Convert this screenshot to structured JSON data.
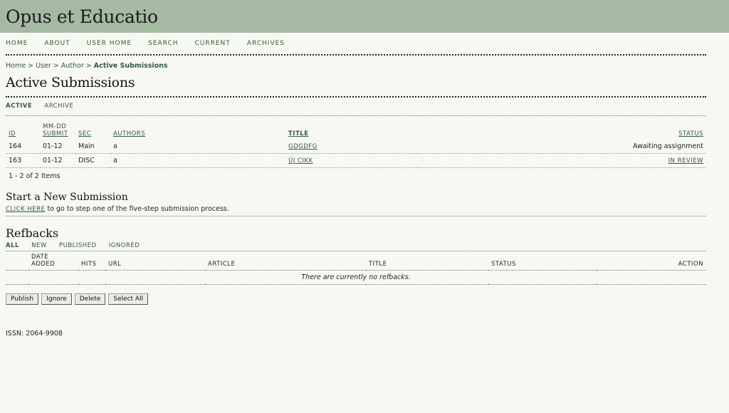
{
  "site": {
    "title": "Opus et Educatio"
  },
  "nav": [
    {
      "label": "HOME"
    },
    {
      "label": "ABOUT"
    },
    {
      "label": "USER HOME"
    },
    {
      "label": "SEARCH"
    },
    {
      "label": "CURRENT"
    },
    {
      "label": "ARCHIVES"
    }
  ],
  "breadcrumb": {
    "home": "Home",
    "sep": ">",
    "user": "User",
    "author": "Author",
    "current": "Active Submissions"
  },
  "page": {
    "title": "Active Submissions"
  },
  "subtabs": {
    "active": "ACTIVE",
    "archive": "ARCHIVE"
  },
  "submissions": {
    "headers": {
      "id": "ID",
      "date_top": "MM-DD",
      "date": "SUBMIT",
      "sec": "SEC",
      "authors": "AUTHORS",
      "title": "TITLE",
      "status": "STATUS"
    },
    "rows": [
      {
        "id": "164",
        "date": "01-12",
        "sec": "Main",
        "authors": "a",
        "title": "GDGDFG",
        "status": "Awaiting assignment"
      },
      {
        "id": "163",
        "date": "01-12",
        "sec": "DISC",
        "authors": "a",
        "title": "ÚJ CIKK",
        "status": "IN REVIEW"
      }
    ],
    "count": "1 - 2 of 2 Items"
  },
  "new_submission": {
    "heading": "Start a New Submission",
    "link": "CLICK HERE",
    "text": "to go to step one of the five-step submission process."
  },
  "refbacks": {
    "heading": "Refbacks",
    "tabs": {
      "all": "ALL",
      "new": "NEW",
      "published": "PUBLISHED",
      "ignored": "IGNORED"
    },
    "headers": {
      "date_top": "DATE",
      "date": "ADDED",
      "hits": "HITS",
      "url": "URL",
      "article": "ARTICLE",
      "title": "TITLE",
      "status": "STATUS",
      "action": "ACTION"
    },
    "empty": "There are currently no refbacks."
  },
  "buttons": {
    "publish": "Publish",
    "ignore": "Ignore",
    "delete": "Delete",
    "select_all": "Select All"
  },
  "footer": {
    "issn": "ISSN: 2064-9908"
  }
}
